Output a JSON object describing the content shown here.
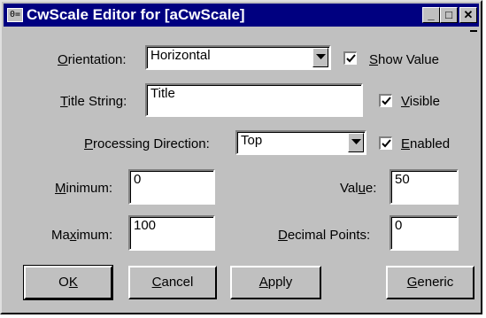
{
  "window": {
    "title": "CwScale Editor for [aCwScale]",
    "sysmenu_glyph": "0=",
    "minimize_glyph": "_",
    "maximize_glyph": "□",
    "close_glyph": "✕"
  },
  "orientation": {
    "label": "Orientation:",
    "value": "Horizontal"
  },
  "show_value": {
    "label": "Show Value",
    "checked": true
  },
  "title_string": {
    "label": "Title String:",
    "value": "Title"
  },
  "visible": {
    "label": "Visible",
    "checked": true
  },
  "processing_direction": {
    "label": "Processing Direction:",
    "value": "Top"
  },
  "enabled": {
    "label": "Enabled",
    "checked": true
  },
  "minimum": {
    "label": "Minimum:",
    "value": "0"
  },
  "maximum": {
    "label": "Maximum:",
    "value": "100"
  },
  "value": {
    "label": "Value:",
    "value": "50"
  },
  "decimal_points": {
    "label": "Decimal Points:",
    "value": "0"
  },
  "buttons": {
    "ok": "OK",
    "cancel": "Cancel",
    "apply": "Apply",
    "generic": "Generic"
  }
}
